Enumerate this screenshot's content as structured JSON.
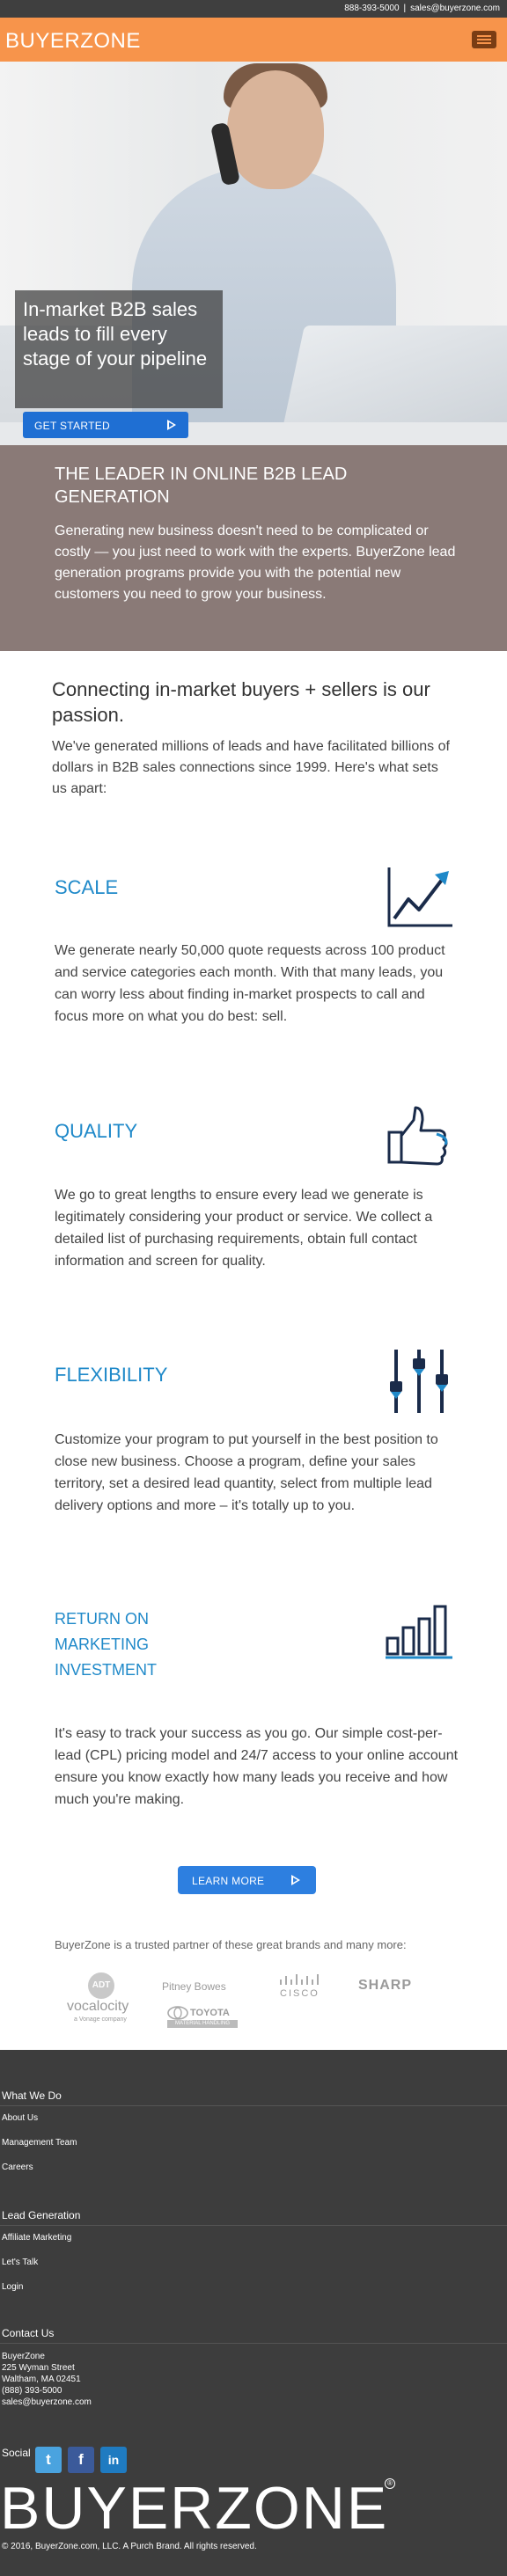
{
  "topbar": {
    "phone": "888-393-5000",
    "separator": "|",
    "email": "sales@buyerzone.com"
  },
  "header": {
    "logo": "BUYERZONE",
    "menu_icon": "hamburger-icon",
    "brand_color": "#f7944b"
  },
  "hero": {
    "title": "In-market B2B sales leads to fill every stage of your pipeline",
    "cta_label": "GET STARTED",
    "cta_icon": "play-icon"
  },
  "leader": {
    "title": "THE LEADER IN ONLINE B2B LEAD GENERATION",
    "body": "Generating new business doesn't need to be complicated or costly — you just need to work with the experts. BuyerZone lead generation programs provide you with the potential new customers you need to grow your business."
  },
  "intro": {
    "heading": "Connecting in-market buyers + sellers is our passion.",
    "body": "We've generated millions of leads and have facilitated billions of dollars in B2B sales connections since 1999. Here's what sets us apart:"
  },
  "features": [
    {
      "title": "SCALE",
      "icon": "growth-chart-icon",
      "text": "We generate nearly 50,000 quote requests across 100 product and service categories each month. With that many leads, you can worry less about finding in-market prospects to call and focus more on what you do best: sell."
    },
    {
      "title": "QUALITY",
      "icon": "thumbs-up-icon",
      "text": "We go to great lengths to ensure every lead we generate is legitimately considering your product or service. We collect a detailed list of purchasing requirements, obtain full contact information and screen for quality."
    },
    {
      "title": "FLEXIBILITY",
      "icon": "sliders-icon",
      "text": "Customize your program to put yourself in the best position to close new business. Choose a program, define your sales territory, set a desired lead quantity, select from multiple lead delivery options and more – it's totally up to you."
    },
    {
      "title": "RETURN ON MARKETING INVESTMENT",
      "icon": "bar-chart-icon",
      "text": "It's easy to track your success as you go. Our simple cost-per-lead (CPL) pricing model and 24/7 access to your online account ensure you know exactly how many leads you receive and how much you're making."
    }
  ],
  "learn_more": {
    "label": "LEARN MORE",
    "icon": "play-icon"
  },
  "partners": {
    "text": "BuyerZone is a trusted partner of these great brands and many more:",
    "brands": [
      {
        "name": "ADT",
        "sub": "vocalocity",
        "tag": "a Vonage company"
      },
      {
        "name": "Pitney Bowes"
      },
      {
        "name": "CISCO"
      },
      {
        "name": "SHARP"
      },
      {
        "name": "TOYOTA",
        "tag": "MATERIAL HANDLING"
      }
    ]
  },
  "footer": {
    "what_we_do": "What We Do",
    "about_us": "About Us",
    "management_team": "Management Team",
    "careers": "Careers",
    "lead_generation": "Lead Generation",
    "affiliate_marketing": "Affiliate Marketing",
    "lets_talk": "Let's Talk",
    "login": "Login",
    "contact_us": "Contact Us",
    "address": {
      "name": "BuyerZone",
      "street": "225 Wyman Street",
      "city": "Waltham, MA 02451",
      "phone": "(888) 393-5000",
      "email": "sales@buyerzone.com"
    },
    "social_label": "Social",
    "social": [
      {
        "icon": "twitter-icon",
        "glyph": "t",
        "color": "#4aa3df"
      },
      {
        "icon": "facebook-icon",
        "glyph": "f",
        "color": "#3b5a9a"
      },
      {
        "icon": "linkedin-icon",
        "glyph": "in",
        "color": "#1f7bc1"
      }
    ],
    "logo": "BUYERZONE",
    "registered": "®",
    "copyright": "© 2016, BuyerZone.com, LLC. A Purch Brand. All rights reserved."
  }
}
